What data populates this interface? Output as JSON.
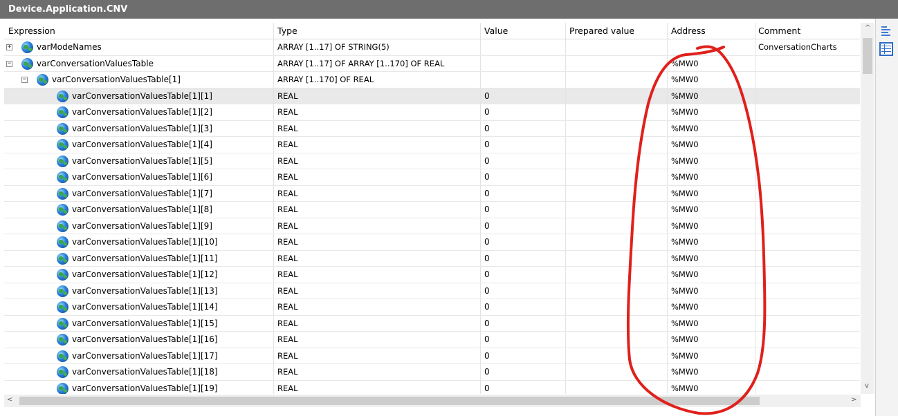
{
  "window": {
    "title": "Device.Application.CNV"
  },
  "columns": {
    "expression": "Expression",
    "type": "Type",
    "value": "Value",
    "prepared": "Prepared value",
    "address": "Address",
    "comment": "Comment"
  },
  "rows": [
    {
      "level": 0,
      "toggle": "+",
      "name": "varModeNames",
      "type": "ARRAY [1..17] OF STRING(5)",
      "value": "",
      "address": "",
      "comment": "ConversationCharts"
    },
    {
      "level": 0,
      "toggle": "−",
      "name": "varConversationValuesTable",
      "type": "ARRAY [1..17] OF ARRAY [1..170] OF REAL",
      "value": "",
      "address": "%MW0",
      "comment": ""
    },
    {
      "level": 1,
      "toggle": "−",
      "name": "varConversationValuesTable[1]",
      "type": "ARRAY [1..170] OF REAL",
      "value": "",
      "address": "%MW0",
      "comment": ""
    },
    {
      "level": 2,
      "toggle": "",
      "name": "varConversationValuesTable[1][1]",
      "type": "REAL",
      "value": "0",
      "address": "%MW0",
      "comment": "",
      "selected": true
    },
    {
      "level": 2,
      "toggle": "",
      "name": "varConversationValuesTable[1][2]",
      "type": "REAL",
      "value": "0",
      "address": "%MW0",
      "comment": ""
    },
    {
      "level": 2,
      "toggle": "",
      "name": "varConversationValuesTable[1][3]",
      "type": "REAL",
      "value": "0",
      "address": "%MW0",
      "comment": ""
    },
    {
      "level": 2,
      "toggle": "",
      "name": "varConversationValuesTable[1][4]",
      "type": "REAL",
      "value": "0",
      "address": "%MW0",
      "comment": ""
    },
    {
      "level": 2,
      "toggle": "",
      "name": "varConversationValuesTable[1][5]",
      "type": "REAL",
      "value": "0",
      "address": "%MW0",
      "comment": ""
    },
    {
      "level": 2,
      "toggle": "",
      "name": "varConversationValuesTable[1][6]",
      "type": "REAL",
      "value": "0",
      "address": "%MW0",
      "comment": ""
    },
    {
      "level": 2,
      "toggle": "",
      "name": "varConversationValuesTable[1][7]",
      "type": "REAL",
      "value": "0",
      "address": "%MW0",
      "comment": ""
    },
    {
      "level": 2,
      "toggle": "",
      "name": "varConversationValuesTable[1][8]",
      "type": "REAL",
      "value": "0",
      "address": "%MW0",
      "comment": ""
    },
    {
      "level": 2,
      "toggle": "",
      "name": "varConversationValuesTable[1][9]",
      "type": "REAL",
      "value": "0",
      "address": "%MW0",
      "comment": ""
    },
    {
      "level": 2,
      "toggle": "",
      "name": "varConversationValuesTable[1][10]",
      "type": "REAL",
      "value": "0",
      "address": "%MW0",
      "comment": ""
    },
    {
      "level": 2,
      "toggle": "",
      "name": "varConversationValuesTable[1][11]",
      "type": "REAL",
      "value": "0",
      "address": "%MW0",
      "comment": ""
    },
    {
      "level": 2,
      "toggle": "",
      "name": "varConversationValuesTable[1][12]",
      "type": "REAL",
      "value": "0",
      "address": "%MW0",
      "comment": ""
    },
    {
      "level": 2,
      "toggle": "",
      "name": "varConversationValuesTable[1][13]",
      "type": "REAL",
      "value": "0",
      "address": "%MW0",
      "comment": ""
    },
    {
      "level": 2,
      "toggle": "",
      "name": "varConversationValuesTable[1][14]",
      "type": "REAL",
      "value": "0",
      "address": "%MW0",
      "comment": ""
    },
    {
      "level": 2,
      "toggle": "",
      "name": "varConversationValuesTable[1][15]",
      "type": "REAL",
      "value": "0",
      "address": "%MW0",
      "comment": ""
    },
    {
      "level": 2,
      "toggle": "",
      "name": "varConversationValuesTable[1][16]",
      "type": "REAL",
      "value": "0",
      "address": "%MW0",
      "comment": ""
    },
    {
      "level": 2,
      "toggle": "",
      "name": "varConversationValuesTable[1][17]",
      "type": "REAL",
      "value": "0",
      "address": "%MW0",
      "comment": ""
    },
    {
      "level": 2,
      "toggle": "",
      "name": "varConversationValuesTable[1][18]",
      "type": "REAL",
      "value": "0",
      "address": "%MW0",
      "comment": ""
    },
    {
      "level": 2,
      "toggle": "",
      "name": "varConversationValuesTable[1][19]",
      "type": "REAL",
      "value": "0",
      "address": "%MW0",
      "comment": ""
    }
  ],
  "scroll": {
    "up": "^",
    "down": "v",
    "left": "<",
    "right": ">"
  },
  "icons": {
    "variable": "globe-variable-icon",
    "annotation": "red-freehand-circle",
    "annotation_color": "#e0201b"
  },
  "colors": {
    "titlebar": "#6e6e6e",
    "selected_row": "#e9e9e9"
  }
}
